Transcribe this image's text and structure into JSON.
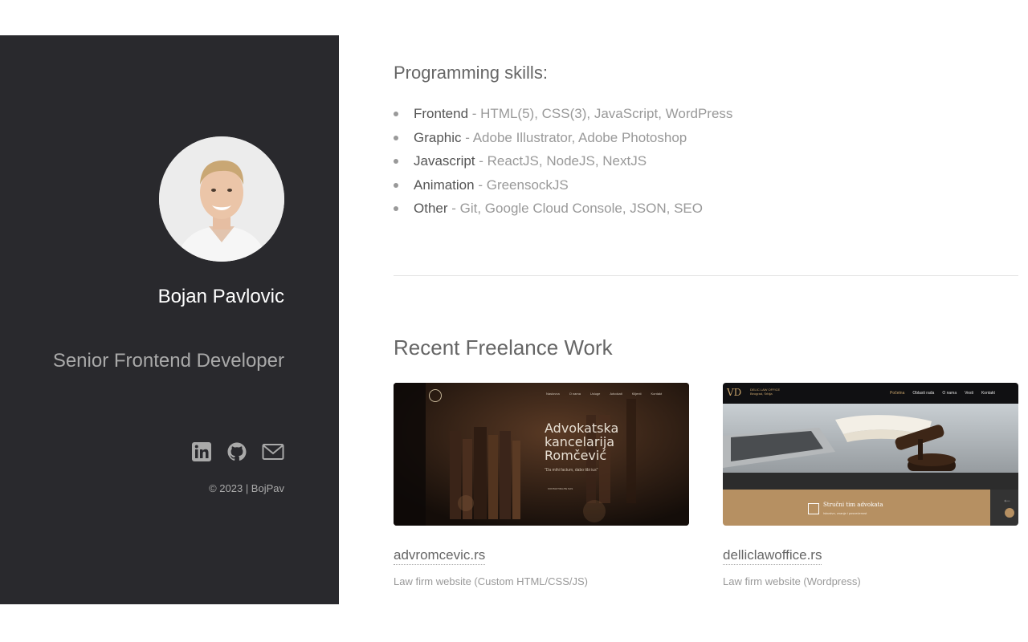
{
  "profile": {
    "name": "Bojan Pavlovic",
    "role": "Senior Frontend Developer",
    "copyright": "© 2023 | BojPav",
    "social": [
      {
        "icon": "linkedin-icon"
      },
      {
        "icon": "github-icon"
      },
      {
        "icon": "mail-icon"
      }
    ]
  },
  "skills": {
    "title": "Programming skills:",
    "items": [
      {
        "category": "Frontend",
        "details": " - HTML(5), CSS(3), JavaScript, WordPress"
      },
      {
        "category": "Graphic",
        "details": " - Adobe Illustrator, Adobe Photoshop"
      },
      {
        "category": "Javascript",
        "details": " - ReactJS, NodeJS, NextJS"
      },
      {
        "category": "Animation",
        "details": " - GreensockJS"
      },
      {
        "category": "Other",
        "details": " - Git, Google Cloud Console, JSON, SEO"
      }
    ]
  },
  "work": {
    "title": "Recent Freelance Work",
    "items": [
      {
        "link": "advromcevic.rs",
        "description": "Law firm website (Custom HTML/CSS/JS)",
        "preview": {
          "nav": [
            "Naslovna",
            "O nama",
            "Usluge",
            "Advokati",
            "Klijenti",
            "Kontakt"
          ],
          "headline_1": "Advokatska",
          "headline_2": "kancelarija",
          "headline_3": "Romčević",
          "quote": "\"Da mihi factum, dabo tibi ius\"",
          "button": "KONTAKTIRAJTE NAS"
        }
      },
      {
        "link": "delliclawoffice.rs",
        "description": "Law firm website (Wordpress)",
        "preview": {
          "logo": "VD",
          "logo_sub_1": "DELIC LAW OFFICE",
          "logo_sub_2": "Beograd, Srbija",
          "nav": [
            "Početna",
            "Oblasti rada",
            "O nama",
            "Vesti",
            "Kontakt"
          ],
          "banner_title": "Stručni tim advokata",
          "banner_sub": "Iskustvo, znanje i posvećenost"
        }
      }
    ]
  },
  "colors": {
    "sidebar_bg": "#29292d",
    "accent_gold": "#b69062",
    "text_dark": "#555555",
    "text_light": "#999999"
  }
}
